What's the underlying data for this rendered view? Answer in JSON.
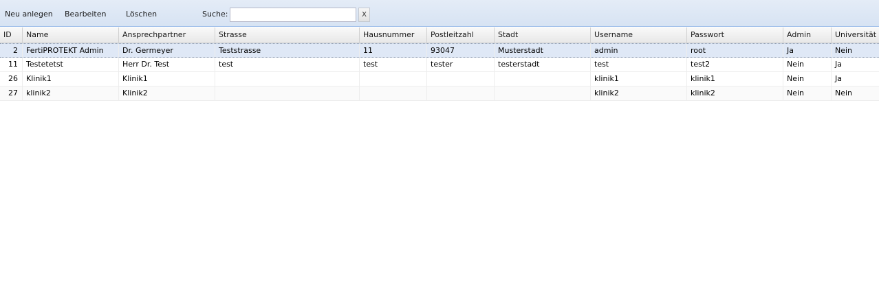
{
  "toolbar": {
    "new_label": "Neu anlegen",
    "edit_label": "Bearbeiten",
    "delete_label": "Löschen",
    "search_label": "Suche:",
    "search_value": "",
    "clear_label": "X"
  },
  "grid": {
    "columns": [
      "ID",
      "Name",
      "Ansprechpartner",
      "Strasse",
      "Hausnummer",
      "Postleitzahl",
      "Stadt",
      "Username",
      "Passwort",
      "Admin",
      "Universität"
    ],
    "rows": [
      {
        "id": "2",
        "name": "FertiPROTEKT Admin",
        "contact": "Dr. Germeyer",
        "street": "Teststrasse",
        "housenr": "11",
        "zip": "93047",
        "city": "Musterstadt",
        "user": "admin",
        "pass": "root",
        "admin": "Ja",
        "uni": "Nein"
      },
      {
        "id": "11",
        "name": "Testetetst",
        "contact": "Herr Dr. Test",
        "street": "test",
        "housenr": "test",
        "zip": "tester",
        "city": "testerstadt",
        "user": "test",
        "pass": "test2",
        "admin": "Nein",
        "uni": "Ja"
      },
      {
        "id": "26",
        "name": "Klinik1",
        "contact": "Klinik1",
        "street": "",
        "housenr": "",
        "zip": "",
        "city": "",
        "user": "klinik1",
        "pass": "klinik1",
        "admin": "Nein",
        "uni": "Ja"
      },
      {
        "id": "27",
        "name": "klinik2",
        "contact": "Klinik2",
        "street": "",
        "housenr": "",
        "zip": "",
        "city": "",
        "user": "klinik2",
        "pass": "klinik2",
        "admin": "Nein",
        "uni": "Nein"
      }
    ],
    "selected_row": 0
  }
}
